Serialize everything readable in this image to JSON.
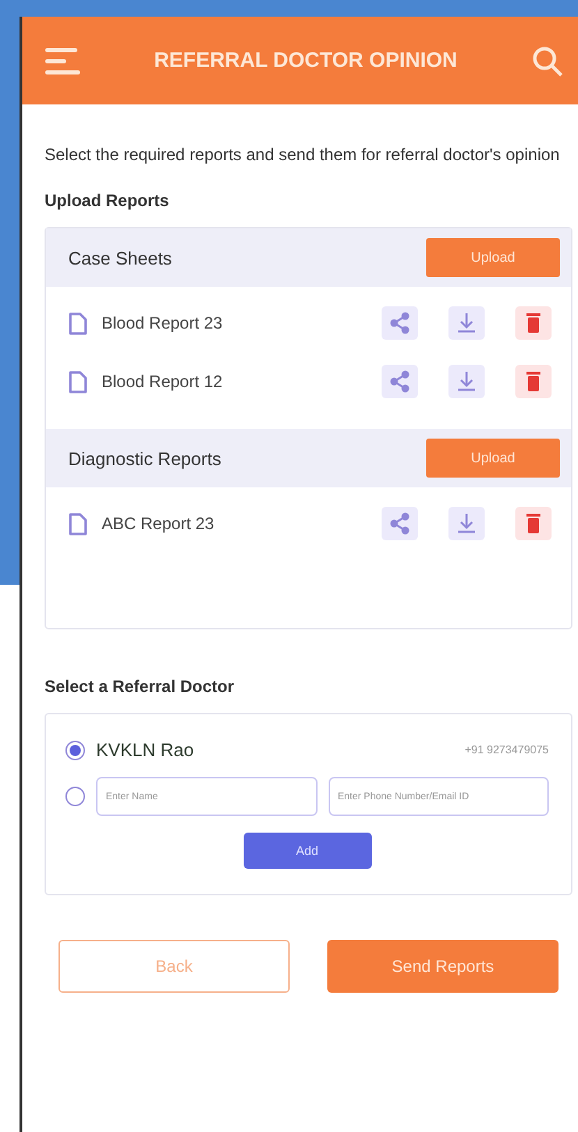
{
  "header": {
    "title": "REFERRAL DOCTOR OPINION"
  },
  "intro": "Select the required reports and send them for referral doctor's opinion",
  "upload_heading": "Upload Reports",
  "sections": [
    {
      "title": "Case Sheets",
      "button": "Upload",
      "files": [
        {
          "name": "Blood Report 23"
        },
        {
          "name": "Blood Report 12"
        }
      ]
    },
    {
      "title": "Diagnostic Reports",
      "button": "Upload",
      "files": [
        {
          "name": "ABC Report 23"
        }
      ]
    }
  ],
  "doctor_heading": "Select a Referral Doctor",
  "doctors": [
    {
      "name": "KVKLN Rao",
      "phone": "+91 9273479075",
      "selected": true
    }
  ],
  "new_doctor": {
    "selected": false,
    "name_placeholder": "Enter Name",
    "contact_placeholder": "Enter Phone Number/Email ID",
    "button": "Add"
  },
  "footer": {
    "back": "Back",
    "send": "Send Reports"
  }
}
